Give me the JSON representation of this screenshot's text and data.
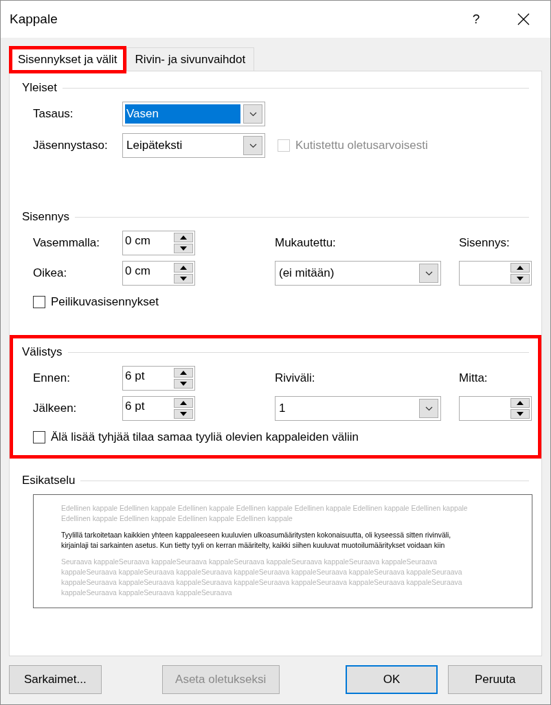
{
  "window": {
    "title": "Kappale",
    "help": "?"
  },
  "tabs": [
    {
      "label": "Sisennykset ja välit",
      "selected": true,
      "highlighted": true
    },
    {
      "label": "Rivin- ja sivunvaihdot",
      "selected": false,
      "highlighted": false
    }
  ],
  "general": {
    "title": "Yleiset",
    "highlighted": false,
    "alignment": {
      "label": "Tasaus:",
      "value": "Vasen",
      "focused": true
    },
    "outline_level": {
      "label": "Jäsennystaso:",
      "value": "Leipäteksti",
      "focused": false
    },
    "collapsed": {
      "label": "Kutistettu oletusarvoisesti",
      "checked": false,
      "disabled": true
    }
  },
  "indentation": {
    "title": "Sisennys",
    "highlighted": false,
    "left": {
      "label": "Vasemmalla:",
      "value": "0 cm"
    },
    "right": {
      "label": "Oikea:",
      "value": "0 cm"
    },
    "special": {
      "label": "Mukautettu:",
      "value": "(ei mitään)"
    },
    "by": {
      "label": "Sisennys:"
    },
    "mirror": {
      "label": "Peilikuvasisennykset",
      "checked": false,
      "disabled": false
    }
  },
  "spacing": {
    "title": "Välistys",
    "highlighted": true,
    "before": {
      "label": "Ennen:",
      "value": "6 pt"
    },
    "after": {
      "label": "Jälkeen:",
      "value": "6 pt"
    },
    "line_spacing": {
      "label": "Riviväli:",
      "value": "1"
    },
    "at": {
      "label": "Mitta:"
    },
    "no_space": {
      "label": "Älä lisää tyhjää tilaa samaa tyyliä olevien kappaleiden väliin",
      "checked": false,
      "disabled": false
    }
  },
  "preview": {
    "title": "Esikatselu",
    "previous": "Edellinen kappale Edellinen kappale Edellinen kappale Edellinen kappale Edellinen kappale Edellinen kappale Edellinen kappale Edellinen kappale Edellinen kappale Edellinen kappale Edellinen kappale",
    "current": "Tyylillä tarkoitetaan kaikkien yhteen kappaleeseen kuuluvien ulkoasumääritysten kokonaisuutta, oli kyseessä sitten rivinväli, kirjainlaji tai sarkainten asetus. Kun tietty tyyli on kerran määritelty, kaikki siihen kuuluvat muotoilumääritykset voidaan kiin",
    "next": "Seuraava kappaleSeuraava kappaleSeuraava kappaleSeuraava kappaleSeuraava kappaleSeuraava kappaleSeuraava kappaleSeuraava kappaleSeuraava kappaleSeuraava kappaleSeuraava kappaleSeuraava kappaleSeuraava kappaleSeuraava kappaleSeuraava kappaleSeuraava kappaleSeuraava kappaleSeuraava kappaleSeuraava kappaleSeuraava kappaleSeuraava kappaleSeuraava kappaleSeuraava kappaleSeuraava"
  },
  "buttons": [
    {
      "label": "Sarkaimet...",
      "disabled": false,
      "default": false
    },
    {
      "label": "Aseta oletukseksi",
      "disabled": true,
      "default": false
    },
    {
      "label": "OK",
      "disabled": false,
      "default": true
    },
    {
      "label": "Peruuta",
      "disabled": false,
      "default": false
    }
  ]
}
